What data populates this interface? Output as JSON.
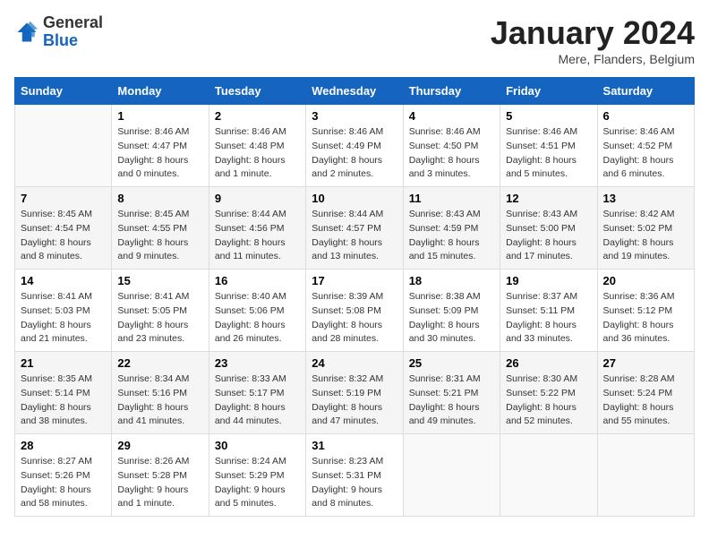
{
  "logo": {
    "general": "General",
    "blue": "Blue"
  },
  "title": "January 2024",
  "location": "Mere, Flanders, Belgium",
  "days_of_week": [
    "Sunday",
    "Monday",
    "Tuesday",
    "Wednesday",
    "Thursday",
    "Friday",
    "Saturday"
  ],
  "weeks": [
    [
      {
        "day": "",
        "sunrise": "",
        "sunset": "",
        "daylight": ""
      },
      {
        "day": "1",
        "sunrise": "Sunrise: 8:46 AM",
        "sunset": "Sunset: 4:47 PM",
        "daylight": "Daylight: 8 hours and 0 minutes."
      },
      {
        "day": "2",
        "sunrise": "Sunrise: 8:46 AM",
        "sunset": "Sunset: 4:48 PM",
        "daylight": "Daylight: 8 hours and 1 minute."
      },
      {
        "day": "3",
        "sunrise": "Sunrise: 8:46 AM",
        "sunset": "Sunset: 4:49 PM",
        "daylight": "Daylight: 8 hours and 2 minutes."
      },
      {
        "day": "4",
        "sunrise": "Sunrise: 8:46 AM",
        "sunset": "Sunset: 4:50 PM",
        "daylight": "Daylight: 8 hours and 3 minutes."
      },
      {
        "day": "5",
        "sunrise": "Sunrise: 8:46 AM",
        "sunset": "Sunset: 4:51 PM",
        "daylight": "Daylight: 8 hours and 5 minutes."
      },
      {
        "day": "6",
        "sunrise": "Sunrise: 8:46 AM",
        "sunset": "Sunset: 4:52 PM",
        "daylight": "Daylight: 8 hours and 6 minutes."
      }
    ],
    [
      {
        "day": "7",
        "sunrise": "Sunrise: 8:45 AM",
        "sunset": "Sunset: 4:54 PM",
        "daylight": "Daylight: 8 hours and 8 minutes."
      },
      {
        "day": "8",
        "sunrise": "Sunrise: 8:45 AM",
        "sunset": "Sunset: 4:55 PM",
        "daylight": "Daylight: 8 hours and 9 minutes."
      },
      {
        "day": "9",
        "sunrise": "Sunrise: 8:44 AM",
        "sunset": "Sunset: 4:56 PM",
        "daylight": "Daylight: 8 hours and 11 minutes."
      },
      {
        "day": "10",
        "sunrise": "Sunrise: 8:44 AM",
        "sunset": "Sunset: 4:57 PM",
        "daylight": "Daylight: 8 hours and 13 minutes."
      },
      {
        "day": "11",
        "sunrise": "Sunrise: 8:43 AM",
        "sunset": "Sunset: 4:59 PM",
        "daylight": "Daylight: 8 hours and 15 minutes."
      },
      {
        "day": "12",
        "sunrise": "Sunrise: 8:43 AM",
        "sunset": "Sunset: 5:00 PM",
        "daylight": "Daylight: 8 hours and 17 minutes."
      },
      {
        "day": "13",
        "sunrise": "Sunrise: 8:42 AM",
        "sunset": "Sunset: 5:02 PM",
        "daylight": "Daylight: 8 hours and 19 minutes."
      }
    ],
    [
      {
        "day": "14",
        "sunrise": "Sunrise: 8:41 AM",
        "sunset": "Sunset: 5:03 PM",
        "daylight": "Daylight: 8 hours and 21 minutes."
      },
      {
        "day": "15",
        "sunrise": "Sunrise: 8:41 AM",
        "sunset": "Sunset: 5:05 PM",
        "daylight": "Daylight: 8 hours and 23 minutes."
      },
      {
        "day": "16",
        "sunrise": "Sunrise: 8:40 AM",
        "sunset": "Sunset: 5:06 PM",
        "daylight": "Daylight: 8 hours and 26 minutes."
      },
      {
        "day": "17",
        "sunrise": "Sunrise: 8:39 AM",
        "sunset": "Sunset: 5:08 PM",
        "daylight": "Daylight: 8 hours and 28 minutes."
      },
      {
        "day": "18",
        "sunrise": "Sunrise: 8:38 AM",
        "sunset": "Sunset: 5:09 PM",
        "daylight": "Daylight: 8 hours and 30 minutes."
      },
      {
        "day": "19",
        "sunrise": "Sunrise: 8:37 AM",
        "sunset": "Sunset: 5:11 PM",
        "daylight": "Daylight: 8 hours and 33 minutes."
      },
      {
        "day": "20",
        "sunrise": "Sunrise: 8:36 AM",
        "sunset": "Sunset: 5:12 PM",
        "daylight": "Daylight: 8 hours and 36 minutes."
      }
    ],
    [
      {
        "day": "21",
        "sunrise": "Sunrise: 8:35 AM",
        "sunset": "Sunset: 5:14 PM",
        "daylight": "Daylight: 8 hours and 38 minutes."
      },
      {
        "day": "22",
        "sunrise": "Sunrise: 8:34 AM",
        "sunset": "Sunset: 5:16 PM",
        "daylight": "Daylight: 8 hours and 41 minutes."
      },
      {
        "day": "23",
        "sunrise": "Sunrise: 8:33 AM",
        "sunset": "Sunset: 5:17 PM",
        "daylight": "Daylight: 8 hours and 44 minutes."
      },
      {
        "day": "24",
        "sunrise": "Sunrise: 8:32 AM",
        "sunset": "Sunset: 5:19 PM",
        "daylight": "Daylight: 8 hours and 47 minutes."
      },
      {
        "day": "25",
        "sunrise": "Sunrise: 8:31 AM",
        "sunset": "Sunset: 5:21 PM",
        "daylight": "Daylight: 8 hours and 49 minutes."
      },
      {
        "day": "26",
        "sunrise": "Sunrise: 8:30 AM",
        "sunset": "Sunset: 5:22 PM",
        "daylight": "Daylight: 8 hours and 52 minutes."
      },
      {
        "day": "27",
        "sunrise": "Sunrise: 8:28 AM",
        "sunset": "Sunset: 5:24 PM",
        "daylight": "Daylight: 8 hours and 55 minutes."
      }
    ],
    [
      {
        "day": "28",
        "sunrise": "Sunrise: 8:27 AM",
        "sunset": "Sunset: 5:26 PM",
        "daylight": "Daylight: 8 hours and 58 minutes."
      },
      {
        "day": "29",
        "sunrise": "Sunrise: 8:26 AM",
        "sunset": "Sunset: 5:28 PM",
        "daylight": "Daylight: 9 hours and 1 minute."
      },
      {
        "day": "30",
        "sunrise": "Sunrise: 8:24 AM",
        "sunset": "Sunset: 5:29 PM",
        "daylight": "Daylight: 9 hours and 5 minutes."
      },
      {
        "day": "31",
        "sunrise": "Sunrise: 8:23 AM",
        "sunset": "Sunset: 5:31 PM",
        "daylight": "Daylight: 9 hours and 8 minutes."
      },
      {
        "day": "",
        "sunrise": "",
        "sunset": "",
        "daylight": ""
      },
      {
        "day": "",
        "sunrise": "",
        "sunset": "",
        "daylight": ""
      },
      {
        "day": "",
        "sunrise": "",
        "sunset": "",
        "daylight": ""
      }
    ]
  ]
}
